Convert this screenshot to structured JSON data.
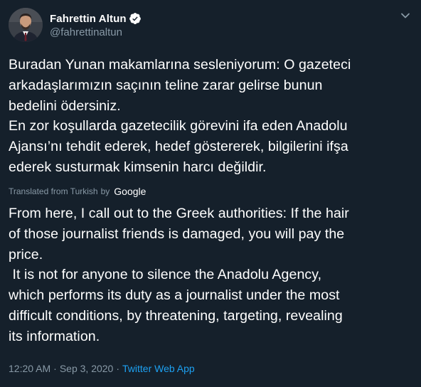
{
  "user": {
    "display_name": "Fahrettin Altun",
    "handle": "@fahrettinaltun",
    "verified": true
  },
  "icons": {
    "verified": "verified-badge-icon",
    "more": "chevron-down-icon",
    "avatar": "profile-photo"
  },
  "tweet": {
    "original_text": "Buradan Yunan makamlarına sesleniyorum: O gazeteci\narkadaşlarımızın saçının teline zarar gelirse bunun\nbedelini ödersiniz.\nEn zor koşullarda gazetecilik görevini ifa eden Anadolu\nAjansı’nı tehdit ederek, hedef göstererek, bilgilerini ifşa\nederek susturmak kimsenin harcı değildir.",
    "translation_label": "Translated from Turkish",
    "translation_by": "by",
    "translation_provider": "Google",
    "translated_text": "From here, I call out to the Greek authorities: If the hair\nof those journalist friends is damaged, you will pay the\nprice.\n It is not for anyone to silence the Anadolu Agency,\nwhich performs its duty as a journalist under the most\ndifficult conditions, by threatening, targeting, revealing\nits information."
  },
  "meta": {
    "time": "12:20 AM",
    "separator1": "·",
    "date": "Sep 3, 2020",
    "separator2": "·",
    "source": "Twitter Web App"
  },
  "colors": {
    "background": "#15202b",
    "text": "#ffffff",
    "secondary_text": "#8899a6",
    "accent": "#1da1f2"
  }
}
